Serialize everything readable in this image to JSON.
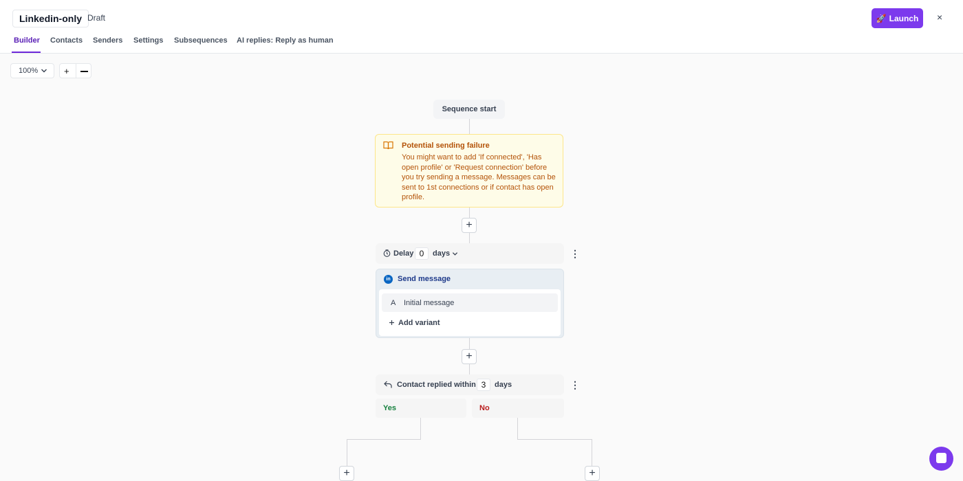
{
  "header": {
    "title": "Linkedin-only",
    "status": "Draft",
    "launch_label": "Launch",
    "launch_icon": "🚀",
    "close_label": "×"
  },
  "tabs": [
    {
      "label": "Builder",
      "active": true
    },
    {
      "label": "Contacts",
      "active": false
    },
    {
      "label": "Senders",
      "active": false
    },
    {
      "label": "Settings",
      "active": false
    },
    {
      "label": "Subsequences",
      "active": false
    },
    {
      "label": "AI replies: Reply as human",
      "active": false
    }
  ],
  "zoom": {
    "value": "100%",
    "plus": "+"
  },
  "flow": {
    "start_label": "Sequence start",
    "warning": {
      "title": "Potential sending failure",
      "body": "You might want to add 'If connected', 'Has open profile' or 'Request connection' before you try sending a message. Messages can be sent to 1st connections or if contact has open profile."
    },
    "add_step_label": "+",
    "delay": {
      "label": "Delay",
      "value": "0",
      "unit": "days"
    },
    "send_message": {
      "title": "Send message",
      "linkedin_icon_text": "in",
      "variants": [
        {
          "letter": "A",
          "label": "Initial message"
        }
      ],
      "add_variant_label": "Add variant"
    },
    "reply_condition": {
      "label": "Contact replied within",
      "value": "3",
      "unit": "days",
      "yes_label": "Yes",
      "no_label": "No"
    },
    "menu_glyph": "⋮"
  },
  "colors": {
    "accent": "#7c3aed",
    "warning_text": "#b45309",
    "warning_bg": "#fefce8",
    "yes": "#15803d",
    "no": "#b91c1c",
    "linkedin": "#0a66c2"
  }
}
